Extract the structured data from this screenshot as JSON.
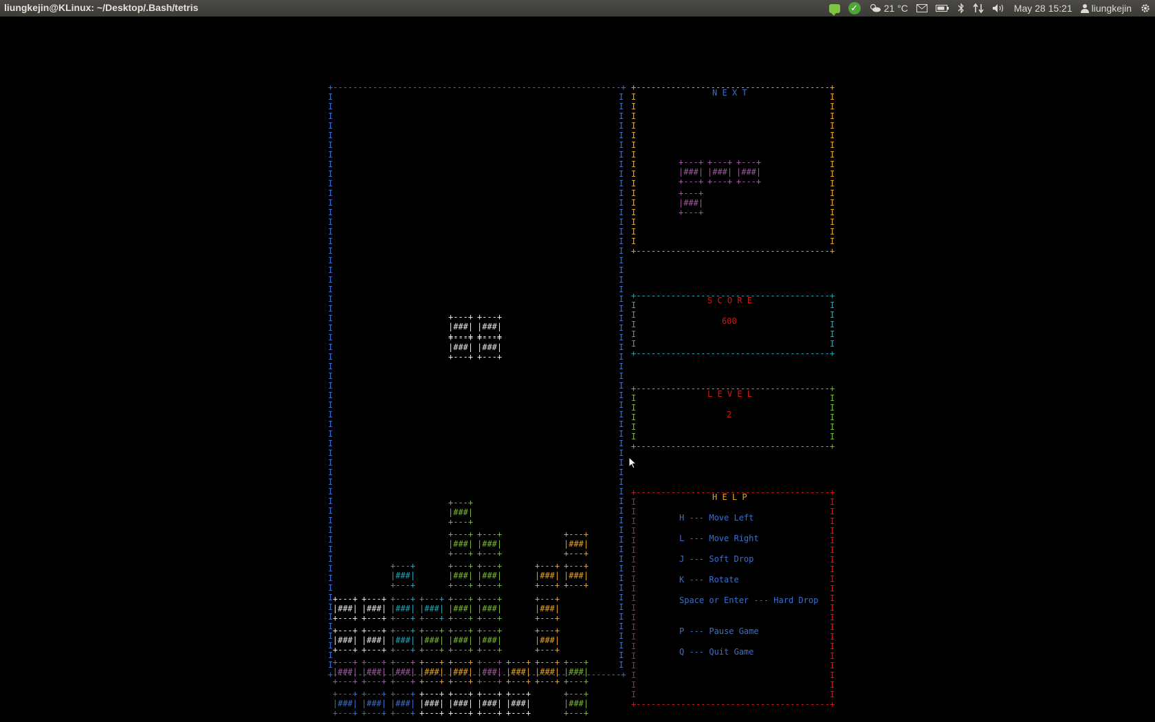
{
  "topbar": {
    "window_title": "liungkejin@KLinux: ~/Desktop/.Bash/tetris",
    "weather_temp": "21 °C",
    "clock": "May 28 15:21",
    "user": "liungkejin",
    "icons": [
      "chat-icon",
      "update-check-icon",
      "weather-icon",
      "mail-icon",
      "battery-icon",
      "bluetooth-icon",
      "network-icon",
      "volume-icon",
      "user-icon",
      "gear-icon"
    ]
  },
  "board": {
    "border_color": "#3b6fc9"
  },
  "next_panel": {
    "title": "N E X T",
    "piece_color": "#9e5c9e",
    "border_color": "#e8a323"
  },
  "score_panel": {
    "title": "S C O R E",
    "value": "600",
    "border_color": "#1fa7b5"
  },
  "level_panel": {
    "title": "L E V E L",
    "value": "2",
    "border_color": "#79b832"
  },
  "help_panel": {
    "title": "H E L P",
    "border_color": "#d01818",
    "lines": [
      "H --- Move Left",
      "L --- Move Right",
      "J --- Soft Drop",
      "K --- Rotate",
      "Space or Enter --- Hard Drop",
      "P --- Pause Game",
      "Q --- Quit Game"
    ]
  },
  "falling_piece": {
    "color": "#e8e8e8",
    "cells": [
      [
        0,
        0
      ],
      [
        1,
        0
      ],
      [
        0,
        1
      ],
      [
        1,
        1
      ]
    ]
  },
  "next_piece_cells": [
    [
      0,
      0
    ],
    [
      1,
      0
    ],
    [
      2,
      0
    ],
    [
      0,
      1
    ]
  ],
  "stack": [
    {
      "col": 4,
      "row": 0,
      "color": "green"
    },
    {
      "col": 4,
      "row": 1,
      "color": "green"
    },
    {
      "col": 5,
      "row": 1,
      "color": "green"
    },
    {
      "col": 8,
      "row": 1,
      "color": "orange"
    },
    {
      "col": 2,
      "row": 2,
      "color": "cyan"
    },
    {
      "col": 4,
      "row": 2,
      "color": "green"
    },
    {
      "col": 5,
      "row": 2,
      "color": "green"
    },
    {
      "col": 7,
      "row": 2,
      "color": "orange"
    },
    {
      "col": 8,
      "row": 2,
      "color": "orange"
    },
    {
      "col": 0,
      "row": 3,
      "color": "white"
    },
    {
      "col": 1,
      "row": 3,
      "color": "white"
    },
    {
      "col": 2,
      "row": 3,
      "color": "cyan"
    },
    {
      "col": 3,
      "row": 3,
      "color": "cyan"
    },
    {
      "col": 4,
      "row": 3,
      "color": "green"
    },
    {
      "col": 5,
      "row": 3,
      "color": "green"
    },
    {
      "col": 7,
      "row": 3,
      "color": "orange"
    },
    {
      "col": 0,
      "row": 4,
      "color": "white"
    },
    {
      "col": 1,
      "row": 4,
      "color": "white"
    },
    {
      "col": 2,
      "row": 4,
      "color": "cyan"
    },
    {
      "col": 3,
      "row": 4,
      "color": "green"
    },
    {
      "col": 4,
      "row": 4,
      "color": "green"
    },
    {
      "col": 5,
      "row": 4,
      "color": "green"
    },
    {
      "col": 7,
      "row": 4,
      "color": "orange"
    },
    {
      "col": 0,
      "row": 5,
      "color": "purple"
    },
    {
      "col": 1,
      "row": 5,
      "color": "purple"
    },
    {
      "col": 2,
      "row": 5,
      "color": "purple"
    },
    {
      "col": 3,
      "row": 5,
      "color": "orange"
    },
    {
      "col": 4,
      "row": 5,
      "color": "orange"
    },
    {
      "col": 5,
      "row": 5,
      "color": "purple"
    },
    {
      "col": 6,
      "row": 5,
      "color": "orange"
    },
    {
      "col": 7,
      "row": 5,
      "color": "orange"
    },
    {
      "col": 8,
      "row": 5,
      "color": "green"
    },
    {
      "col": 0,
      "row": 6,
      "color": "blue"
    },
    {
      "col": 1,
      "row": 6,
      "color": "blue"
    },
    {
      "col": 2,
      "row": 6,
      "color": "blue"
    },
    {
      "col": 3,
      "row": 6,
      "color": "white"
    },
    {
      "col": 4,
      "row": 6,
      "color": "white"
    },
    {
      "col": 5,
      "row": 6,
      "color": "white"
    },
    {
      "col": 6,
      "row": 6,
      "color": "white"
    },
    {
      "col": 8,
      "row": 6,
      "color": "green"
    }
  ]
}
